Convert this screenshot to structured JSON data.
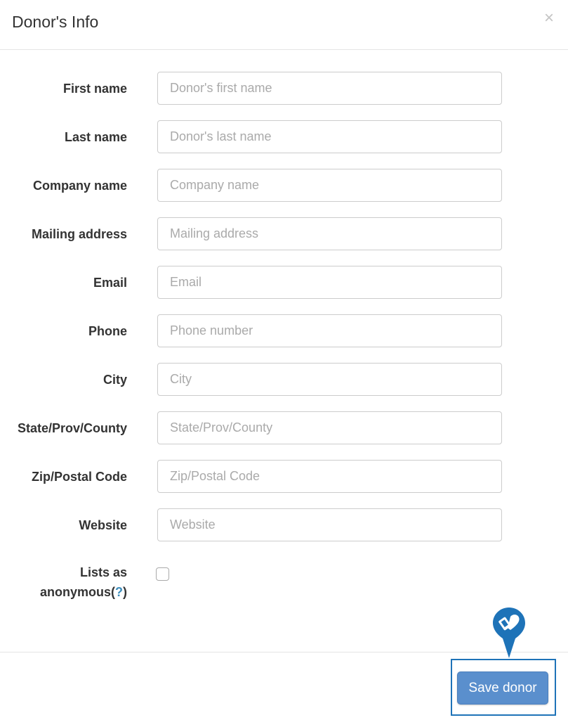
{
  "modal": {
    "title": "Donor's Info",
    "close_label": "×"
  },
  "fields": [
    {
      "label": "First name",
      "placeholder": "Donor's first name",
      "value": ""
    },
    {
      "label": "Last name",
      "placeholder": "Donor's last name",
      "value": ""
    },
    {
      "label": "Company name",
      "placeholder": "Company name",
      "value": ""
    },
    {
      "label": "Mailing address",
      "placeholder": "Mailing address",
      "value": ""
    },
    {
      "label": "Email",
      "placeholder": "Email",
      "value": ""
    },
    {
      "label": "Phone",
      "placeholder": "Phone number",
      "value": ""
    },
    {
      "label": "City",
      "placeholder": "City",
      "value": ""
    },
    {
      "label": "State/Prov/County",
      "placeholder": "State/Prov/County",
      "value": ""
    },
    {
      "label": "Zip/Postal Code",
      "placeholder": "Zip/Postal Code",
      "value": ""
    },
    {
      "label": "Website",
      "placeholder": "Website",
      "value": ""
    }
  ],
  "anonymous": {
    "label_line1": "Lists as",
    "label_line2": "anonymous(",
    "help": "?",
    "label_end": ")",
    "checked": false
  },
  "footer": {
    "save_label": "Save donor"
  },
  "colors": {
    "accent": "#1e73b8",
    "button": "#5a8fcd"
  }
}
